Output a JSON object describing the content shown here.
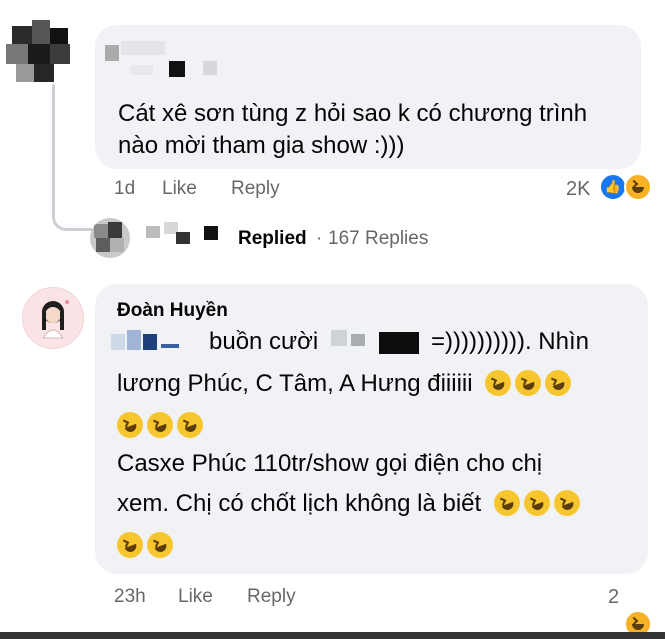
{
  "comment1": {
    "text": "Cát xê sơn tùng z hỏi sao k có chương trình nào mời tham gia show :)))",
    "time": "1d",
    "like_label": "Like",
    "reply_label": "Reply",
    "reaction_count": "2K",
    "reactions": [
      "like-icon",
      "haha-icon"
    ]
  },
  "replies_row": {
    "replied_label": "Replied",
    "separator": "·",
    "replies_count": "167 Replies"
  },
  "comment2": {
    "author": "Đoàn Huyền",
    "line1_visible": "buồn cười",
    "line1_end": "=)))))))))). Nhìn",
    "line2": "lương Phúc, C Tâm, A Hưng điiiiii",
    "line4": "Casxe Phúc 110tr/show gọi điện cho chị",
    "line5": "xem. Chị có chốt lịch không là biết",
    "time": "23h",
    "like_label": "Like",
    "reply_label": "Reply",
    "reaction_count": "2",
    "reactions": [
      "haha-icon"
    ],
    "emoji": "rofl-emoji"
  }
}
